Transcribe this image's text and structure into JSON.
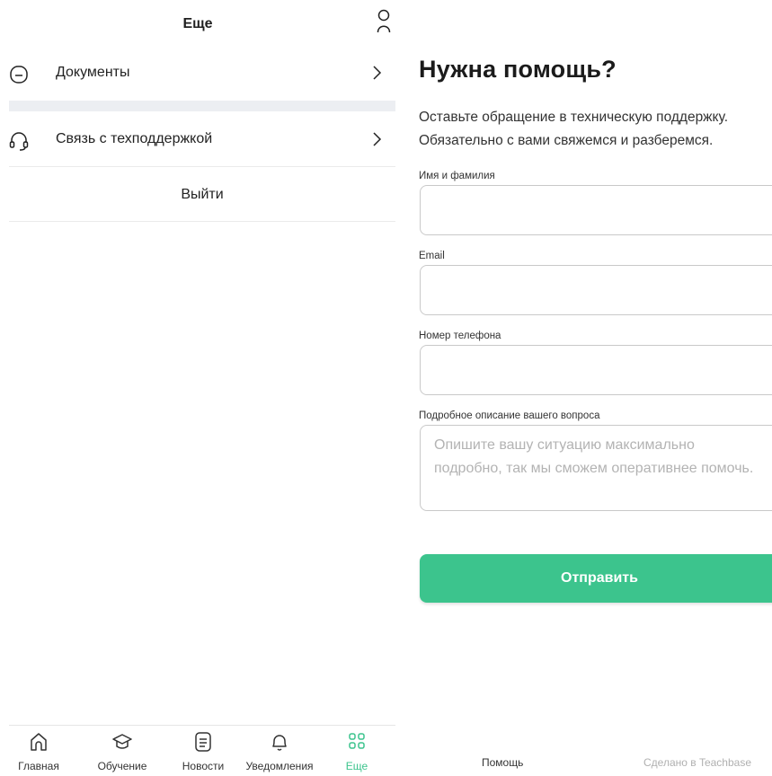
{
  "more_screen": {
    "title": "Еще",
    "profile_icon": "user-icon",
    "menu": [
      {
        "label": "Документы",
        "icon": "document-icon"
      },
      {
        "label": "Связь с техподдержкой",
        "icon": "headset-icon"
      }
    ],
    "logout_label": "Выйти"
  },
  "tabbar": {
    "active_color": "#3cc48d",
    "tabs": [
      {
        "label": "Главная",
        "icon": "home-icon"
      },
      {
        "label": "Обучение",
        "icon": "graduation-cap-icon"
      },
      {
        "label": "Новости",
        "icon": "news-icon"
      },
      {
        "label": "Уведомления",
        "icon": "bell-icon"
      },
      {
        "label": "Еще",
        "icon": "grid-icon",
        "active": true
      }
    ]
  },
  "support_form": {
    "title": "Нужна помощь?",
    "subtitle_line1": "Оставьте обращение в техническую поддержку.",
    "subtitle_line2": "Обязательно с вами свяжемся и разберемся.",
    "fields": {
      "name": {
        "label": "Имя и фамилия",
        "value": ""
      },
      "email": {
        "label": "Email",
        "value": ""
      },
      "phone": {
        "label": "Номер телефона",
        "value": ""
      },
      "description": {
        "label": "Подробное описание вашего вопроса",
        "placeholder": "Опишите вашу ситуацию максимально подробно, так мы сможем оперативнее помочь."
      }
    },
    "submit_label": "Отправить",
    "accent_color": "#3cc48d"
  },
  "footer": {
    "help_link": "Помощь",
    "made_in": "Сделано в Teachbase"
  }
}
